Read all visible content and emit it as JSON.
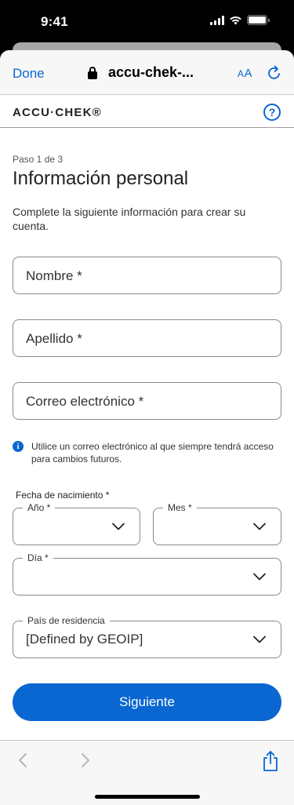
{
  "status_bar": {
    "time": "9:41"
  },
  "browser": {
    "done_label": "Done",
    "url": "accu-chek-...",
    "text_size_label": "A",
    "text_size_label_small": "A"
  },
  "site": {
    "logo": "ACCU·CHEK®",
    "help_label": "?"
  },
  "form": {
    "step": "Paso 1 de 3",
    "title": "Información personal",
    "description": "Complete la siguiente información para crear su cuenta.",
    "first_name_placeholder": "Nombre *",
    "last_name_placeholder": "Apellido *",
    "email_placeholder": "Correo electrónico *",
    "email_info": "Utilice un correo electrónico al que siempre tendrá acceso para cambios futuros.",
    "info_icon_glyph": "i",
    "dob_label": "Fecha de nacimiento *",
    "year_label": "Año *",
    "month_label": "Mes *",
    "day_label": "Día *",
    "country_label": "País de residencia",
    "country_value": "[Defined by GEOIP]",
    "next_button": "Siguiente"
  },
  "colors": {
    "accent": "#0a66d1",
    "border": "#8a8a8a"
  },
  "icons": {
    "lock": "lock-icon",
    "reload": "reload-icon",
    "help": "help-icon",
    "info": "info-icon",
    "chevron": "chevron-down-icon",
    "back": "back-icon",
    "forward": "forward-icon",
    "share": "share-icon"
  }
}
